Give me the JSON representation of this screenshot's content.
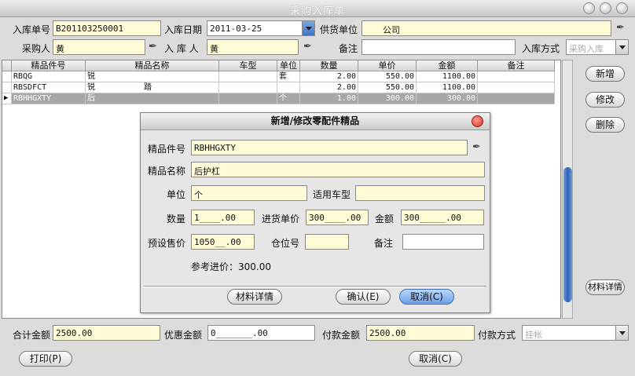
{
  "window": {
    "title": "采购入库单"
  },
  "header": {
    "receipt_no_label": "入库单号",
    "receipt_no": "B201103250001",
    "date_label": "入库日期",
    "date": "2011-03-25",
    "supplier_label": "供货单位",
    "supplier": "公司",
    "buyer_label": "采购人",
    "buyer": "黄",
    "receiver_label": "入 库 人",
    "receiver": "黄",
    "remark_label": "备注",
    "remark": "",
    "method_label": "入库方式",
    "method": "采购入库"
  },
  "grid": {
    "columns": [
      "精品件号",
      "精品名称",
      "车型",
      "单位",
      "数量",
      "单价",
      "金额",
      "备注"
    ],
    "rows": [
      [
        "RBQG",
        "锐",
        "",
        "套",
        "2.00",
        "550.00",
        "1100.00",
        ""
      ],
      [
        "RBSDFCT",
        "锐",
        "",
        "",
        "2.00",
        "550.00",
        "1100.00",
        ""
      ],
      [
        "RBHHGXTY",
        "后",
        "",
        "个",
        "1.00",
        "300.00",
        "300.00",
        ""
      ]
    ],
    "row2_suffix": "踏",
    "current_row_marker": "▶"
  },
  "side_buttons": {
    "add": "新增",
    "edit": "修改",
    "delete": "删除",
    "material": "材料详情"
  },
  "dialog": {
    "title": "新增/修改零配件精品",
    "part_no_label": "精品件号",
    "part_no": "RBHHGXTY",
    "name_label": "精品名称",
    "name": "后护杠",
    "unit_label": "单位",
    "unit": "个",
    "model_label": "适用车型",
    "model": "",
    "qty_label": "数量",
    "qty": "1____.00",
    "price_label": "进货单价",
    "price": "300____.00",
    "amount_label": "金额",
    "amount": "300_____.00",
    "preset_label": "预设售价",
    "preset": "1050__.00",
    "location_label": "仓位号",
    "location": "",
    "remark_label": "备注",
    "remark": "",
    "ref_price": "参考进价：300.00",
    "btn_material": "材料详情",
    "btn_ok": "确认(E)",
    "btn_cancel": "取消(C)"
  },
  "footer": {
    "total_label": "合计金额",
    "total": "2500.00",
    "discount_label": "优惠金额",
    "discount": "0_______.00",
    "paid_label": "付款金额",
    "paid": "2500.00",
    "pay_method_label": "付款方式",
    "pay_method": "挂帐",
    "print": "打印(P)",
    "cancel": "取消(C)"
  }
}
